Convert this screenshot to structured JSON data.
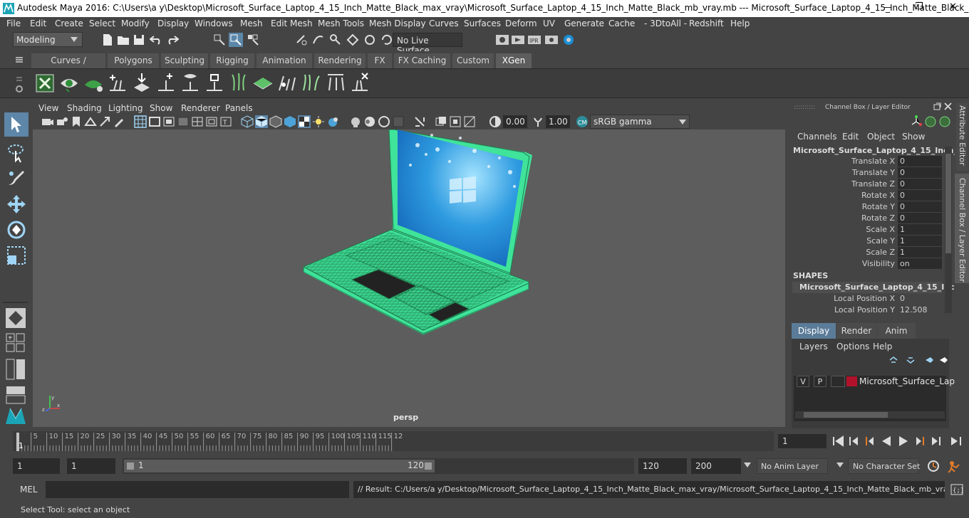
{
  "window": {
    "title": "Autodesk Maya 2016: C:\\Users\\a y\\Desktop\\Microsoft_Surface_Laptop_4_15_Inch_Matte_Black_max_vray\\Microsoft_Surface_Laptop_4_15_Inch_Matte_Black_mb_vray.mb   ---   Microsoft_Surface_Laptop_4_15_Inch_Matte_Black_...",
    "min": "—",
    "restore": "❐",
    "close": "✕"
  },
  "menu": [
    "File",
    "Edit",
    "Create",
    "Select",
    "Modify",
    "Display",
    "Windows",
    "Mesh",
    "Edit Mesh",
    "Mesh Tools",
    "Mesh Display",
    "Curves",
    "Surfaces",
    "Deform",
    "UV",
    "Generate",
    "Cache",
    "- 3DtoAll -",
    "Redshift",
    "Help"
  ],
  "status": {
    "mode": "Modeling",
    "live_surface": "No Live Surface"
  },
  "shelf_tabs": [
    "Curves / Surfaces",
    "Polygons",
    "Sculpting",
    "Rigging",
    "Animation",
    "Rendering",
    "FX",
    "FX Caching",
    "Custom",
    "XGen"
  ],
  "shelf_active": "XGen",
  "viewport": {
    "menus": [
      "View",
      "Shading",
      "Lighting",
      "Show",
      "Renderer",
      "Panels"
    ],
    "near_value": "0.00",
    "far_value": "1.00",
    "color_space": "sRGB gamma",
    "camera": "persp",
    "wire_color": "#3fe39a"
  },
  "channel_box": {
    "header": "Channel Box / Layer Editor",
    "menus": [
      "Channels",
      "Edit",
      "Object",
      "Show"
    ],
    "object_name": "Microsoft_Surface_Laptop_4_15_Inch_...",
    "attrs": [
      {
        "label": "Translate X",
        "value": "0"
      },
      {
        "label": "Translate Y",
        "value": "0"
      },
      {
        "label": "Translate Z",
        "value": "0"
      },
      {
        "label": "Rotate X",
        "value": "0"
      },
      {
        "label": "Rotate Y",
        "value": "0"
      },
      {
        "label": "Rotate Z",
        "value": "0"
      },
      {
        "label": "Scale X",
        "value": "1"
      },
      {
        "label": "Scale Y",
        "value": "1"
      },
      {
        "label": "Scale Z",
        "value": "1"
      },
      {
        "label": "Visibility",
        "value": "on"
      }
    ],
    "shapes_header": "SHAPES",
    "shape_name": "Microsoft_Surface_Laptop_4_15_Inc...",
    "shape_attrs": [
      {
        "label": "Local Position X",
        "value": "0"
      },
      {
        "label": "Local Position Y",
        "value": "12.508"
      }
    ]
  },
  "layer_editor": {
    "tabs": [
      "Display",
      "Render",
      "Anim"
    ],
    "menus": [
      "Layers",
      "Options",
      "Help"
    ],
    "layer": {
      "v": "V",
      "p": "P",
      "name": "Microsoft_Surface_Lapto",
      "color": "#b0122b"
    }
  },
  "side_tabs": [
    "Attribute Editor",
    "Channel Box / Layer Editor"
  ],
  "timeline": {
    "ticks": [
      "5",
      "10",
      "15",
      "20",
      "25",
      "30",
      "35",
      "40",
      "45",
      "50",
      "55",
      "60",
      "65",
      "70",
      "75",
      "80",
      "85",
      "90",
      "95",
      "100",
      "105",
      "110",
      "115",
      "12"
    ],
    "first": "1",
    "current_frame": "1"
  },
  "range": {
    "start": "1",
    "anim_start": "1",
    "slider_start": "1",
    "slider_end": "120",
    "end": "120",
    "anim_end": "200",
    "anim_layer": "No Anim Layer",
    "char_set": "No Character Set"
  },
  "cmd": {
    "label": "MEL",
    "result": "// Result: C:/Users/a y/Desktop/Microsoft_Surface_Laptop_4_15_Inch_Matte_Black_max_vray/Microsoft_Surface_Laptop_4_15_Inch_Matte_Black_mb_vray.mb"
  },
  "help_line": "Select Tool: select an object"
}
